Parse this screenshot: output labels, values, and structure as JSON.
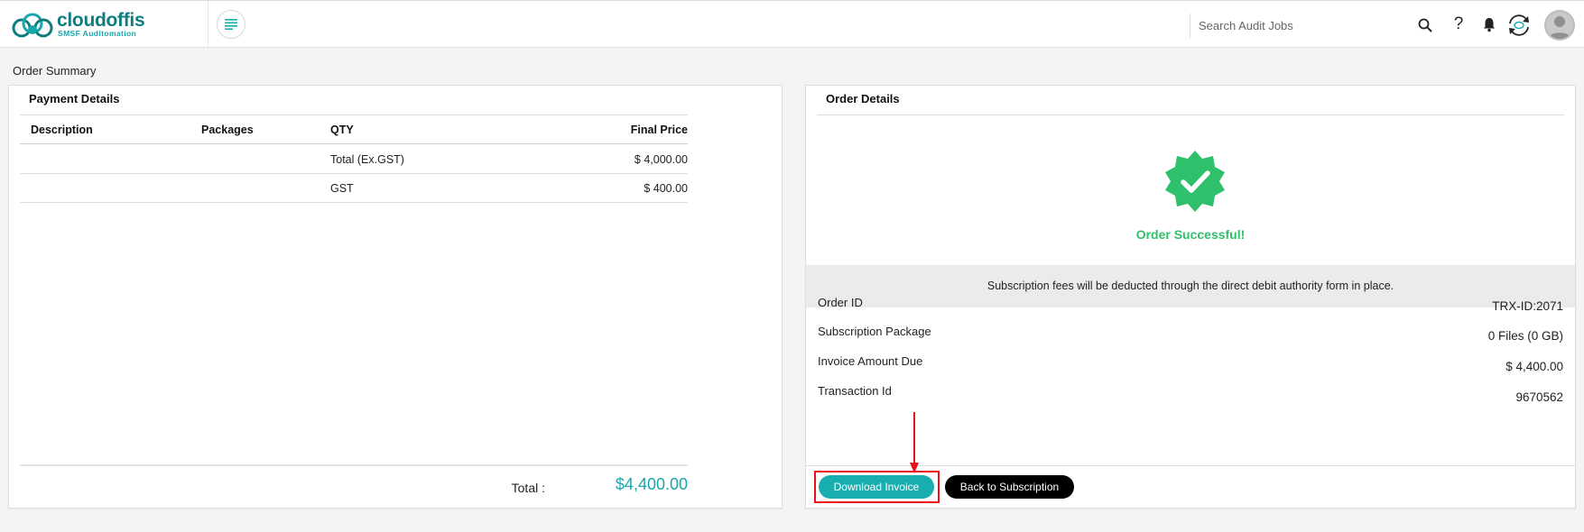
{
  "header": {
    "logo_name": "cloudoffis",
    "logo_tagline": "SMSF Auditomation",
    "search_placeholder": "Search Audit Jobs",
    "help_glyph": "?",
    "icons": [
      "menu-icon",
      "search-icon",
      "help-icon",
      "bell-icon",
      "sync-icon",
      "avatar"
    ]
  },
  "page": {
    "title": "Order Summary"
  },
  "payment": {
    "heading": "Payment Details",
    "columns": [
      "Description",
      "Packages",
      "QTY",
      "Final Price"
    ],
    "rows": [
      {
        "description": "",
        "packages": "",
        "qty": "Total (Ex.GST)",
        "price": "$ 4,000.00"
      },
      {
        "description": "",
        "packages": "",
        "qty": "GST",
        "price": "$ 400.00"
      }
    ],
    "total_label": "Total :",
    "total_value": "$4,400.00"
  },
  "order": {
    "heading": "Order Details",
    "success_text": "Order Successful!",
    "notice": "Subscription fees will be deducted through the direct debit authority form in place.",
    "fields": [
      {
        "label": "Order ID",
        "value": "TRX-ID:2071"
      },
      {
        "label": "Subscription Package",
        "value": "0 Files (0 GB)"
      },
      {
        "label": "Invoice Amount Due",
        "value": "$ 4,400.00"
      },
      {
        "label": "Transaction Id",
        "value": "9670562"
      }
    ],
    "download_label": "Download Invoice",
    "back_label": "Back to Subscription"
  },
  "colors": {
    "brand": "#0f7d80",
    "accent": "#18aeb0",
    "success": "#2fc06b",
    "highlight": "#e8121b"
  }
}
